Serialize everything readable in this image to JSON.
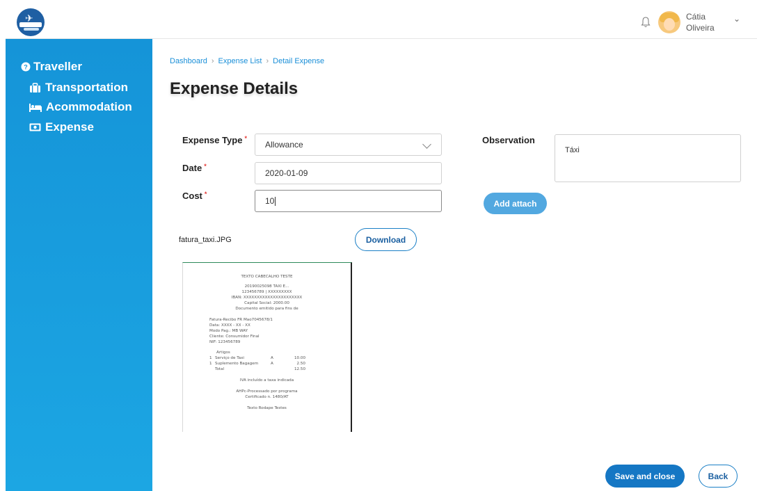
{
  "header": {
    "user": {
      "first_name": "Cátia",
      "last_name": "Oliveira"
    },
    "icons": {
      "logo": "airline-logo",
      "bell": "bell-icon",
      "chevron": "chevron-down-icon"
    }
  },
  "sidebar": {
    "root_label": "Traveller",
    "items": [
      {
        "label": "Transportation",
        "icon": "briefcase-icon"
      },
      {
        "label": "Acommodation",
        "icon": "bed-icon"
      },
      {
        "label": "Expense",
        "icon": "money-icon"
      }
    ],
    "background": "#1a9ee0"
  },
  "breadcrumb": [
    "Dashboard",
    "Expense List",
    "Detail Expense"
  ],
  "page": {
    "title": "Expense Details"
  },
  "form": {
    "expense_type": {
      "label": "Expense Type",
      "value": "Allowance",
      "required": "*"
    },
    "date": {
      "label": "Date",
      "value": "2020-01-09",
      "required": "*"
    },
    "cost": {
      "label": "Cost",
      "value": "10",
      "required": "*"
    },
    "observation": {
      "label": "Observation",
      "value": "Táxi"
    },
    "add_attach_label": "Add attach"
  },
  "attachment": {
    "filename": "fatura_taxi.JPG",
    "download_label": "Download",
    "receipt": {
      "header": "TEXTO CABECALHO TESTE",
      "company": "20190025098 TAXI E...",
      "nif_line": "123456789 | XXXXXXXXX",
      "iban": "IBAN: XXXXXXXXXXXXXXXXXXXXXX",
      "capital": "Capital Social: 2000.00",
      "issued": "Documento emitido para fins de",
      "invoice": "Fatura-Recibo FR Mao7045678/1",
      "data_line": "Data: XXXX - XX - XX",
      "payment": "Modo Pag.: MB WAY",
      "client": "Cliente: Consumidor Final",
      "nif": "NIF: 123456789",
      "items_title": "Artigos",
      "items": [
        {
          "qty": "1",
          "name": "Serviço de Taxi",
          "tax": "A",
          "price": "10.00"
        },
        {
          "qty": "1",
          "name": "Suplemento Bagagem",
          "tax": "A",
          "price": "2.50"
        }
      ],
      "total_label": "Total",
      "total_value": "12.50",
      "iva_note": "IVA incluído a taxa indicada",
      "processed": "AHPc-Processado por programa",
      "certificate": "Certificado n. 1480/AT",
      "footer": "Texto Rodape Testes"
    }
  },
  "actions": {
    "save_close_label": "Save and close",
    "back_label": "Back"
  },
  "colors": {
    "accent": "#1577c4",
    "secondary_button": "#52a8e0",
    "required": "#e53935",
    "link": "#1a8fd8"
  }
}
